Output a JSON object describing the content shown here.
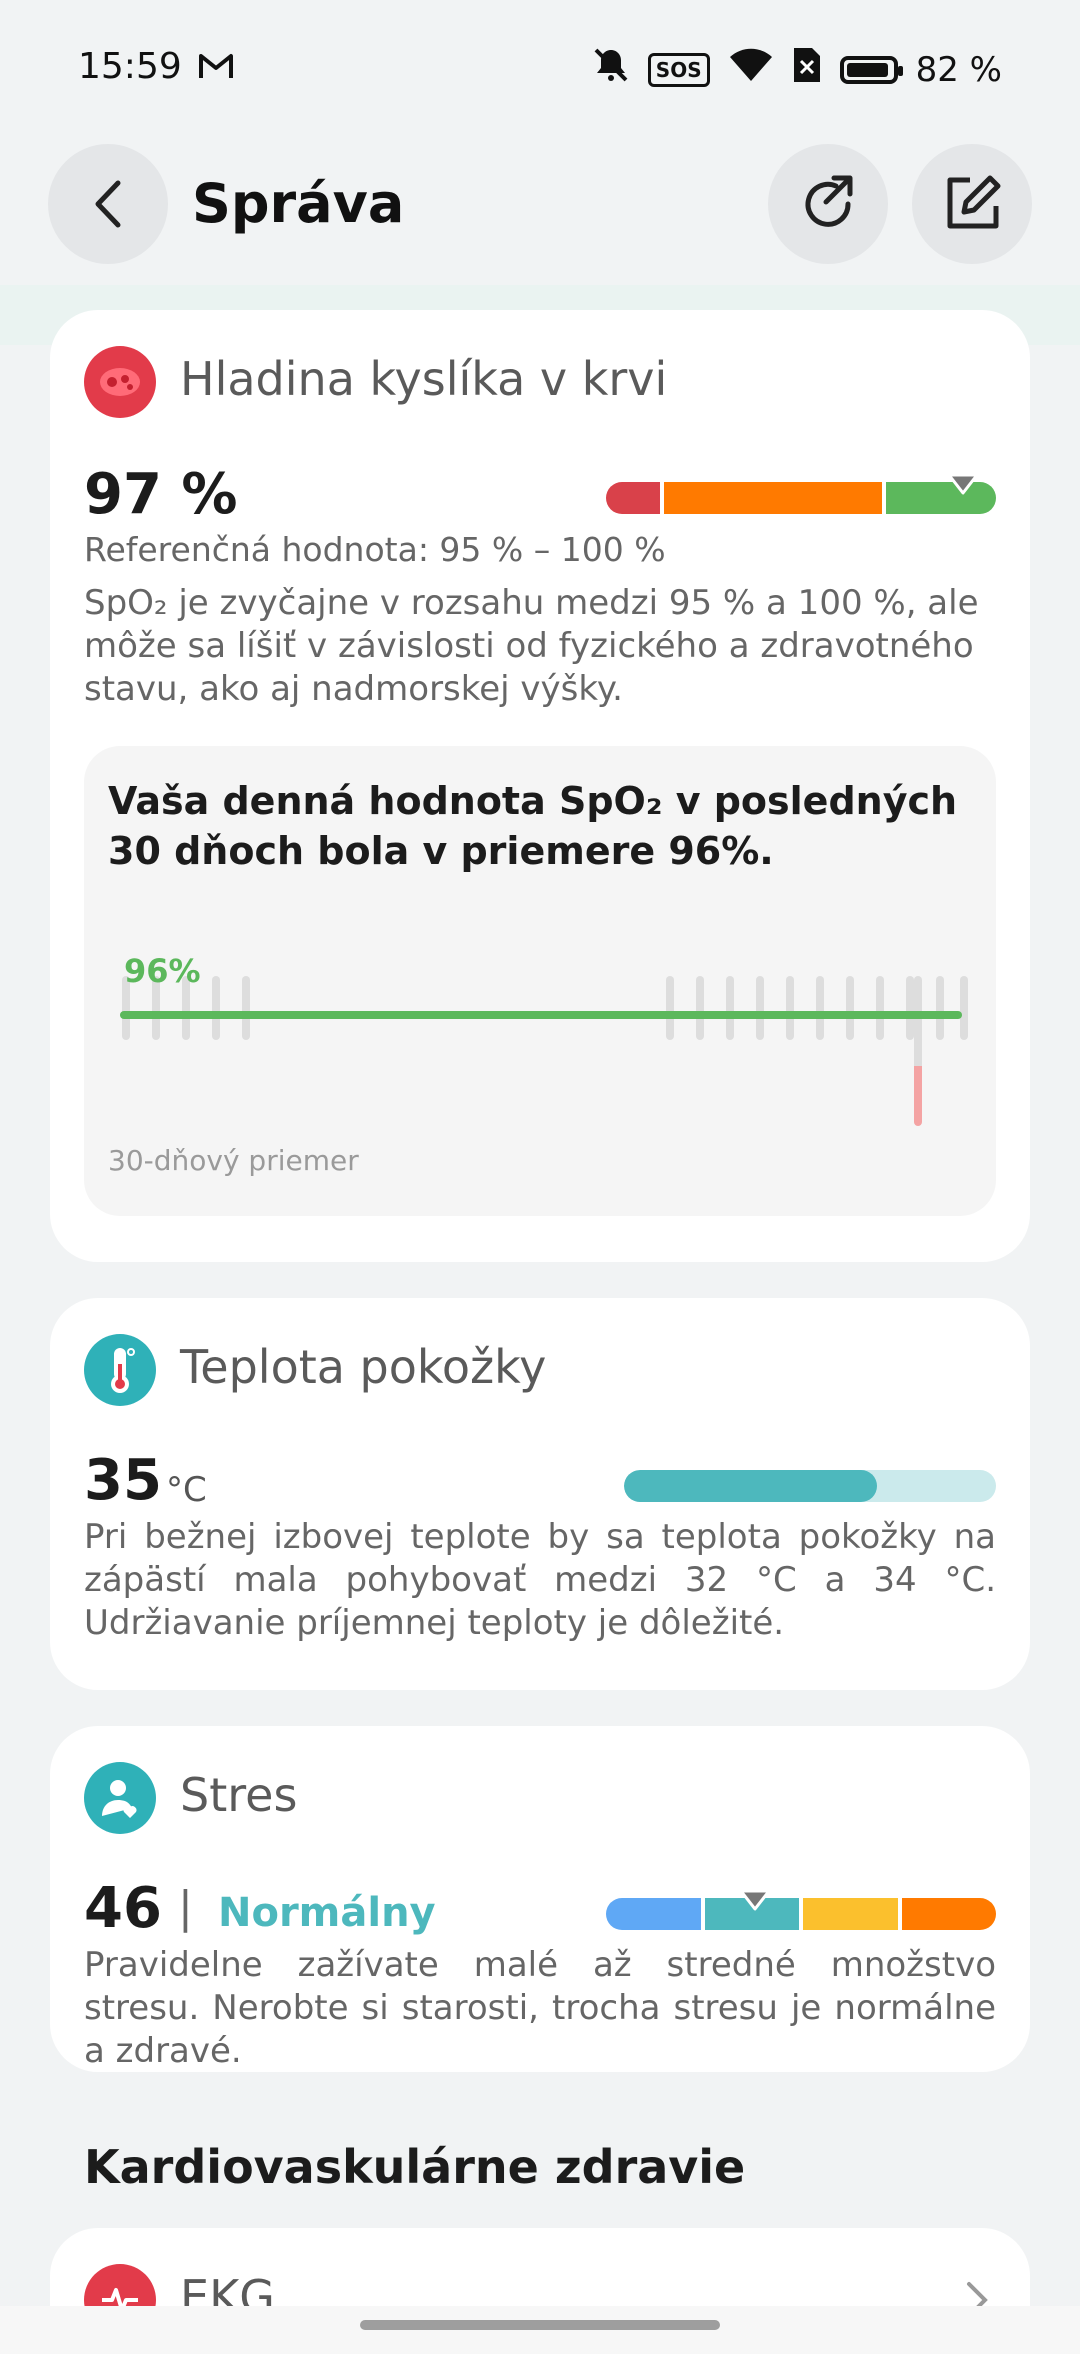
{
  "status_bar": {
    "time": "15:59",
    "battery_percent": "82 %",
    "battery_level": 0.82,
    "sos_label": "SOS",
    "icons": [
      "gmail-icon",
      "mute-icon",
      "sos-icon",
      "wifi-icon",
      "sim-off-icon",
      "battery-icon"
    ]
  },
  "header": {
    "title": "Správa",
    "back_icon": "back-arrow-icon",
    "share_icon": "share-icon",
    "edit_icon": "edit-icon"
  },
  "spo2": {
    "title": "Hladina kyslíka v krvi",
    "value": "97 %",
    "reference": "Referenčná hodnota: 95 % – 100 %",
    "description": "SpO₂ je zvyčajne v rozsahu medzi 95 % a 100 %, ale môže sa líšiť v závislosti od fyzického a zdravotného stavu, ako aj nadmorskej výšky.",
    "colors": {
      "low": "#d9414a",
      "mid": "#ff7a00",
      "high": "#5cb85c"
    },
    "inner": {
      "heading": "Vaša denná hodnota SpO₂ v posledných 30 dňoch bola v priemere 96%.",
      "average_label": "96%",
      "footer": "30-dňový priemer"
    }
  },
  "skin_temp": {
    "title": "Teplota pokožky",
    "value": "35",
    "unit": "°C",
    "description": "Pri bežnej izbovej teplote by sa teplota pokožky na zápästí mala pohybovať medzi 32 °C a 34 °C. Udržiavanie príjemnej teploty je dôležité.",
    "bar_fill_fraction": 0.68,
    "color": "#4db8bd"
  },
  "stress": {
    "title": "Stres",
    "value": "46",
    "separator": "|",
    "status": "Normálny",
    "description": "Pravidelne zažívate malé až stredné množstvo stresu. Nerobte si starosti, trocha stresu je normálne a zdravé.",
    "colors": [
      "#5fa8f5",
      "#4db8bd",
      "#fbc02d",
      "#ff7a00"
    ]
  },
  "section": {
    "heading": "Kardiovaskulárne zdravie"
  },
  "ekg": {
    "title": "EKG"
  }
}
